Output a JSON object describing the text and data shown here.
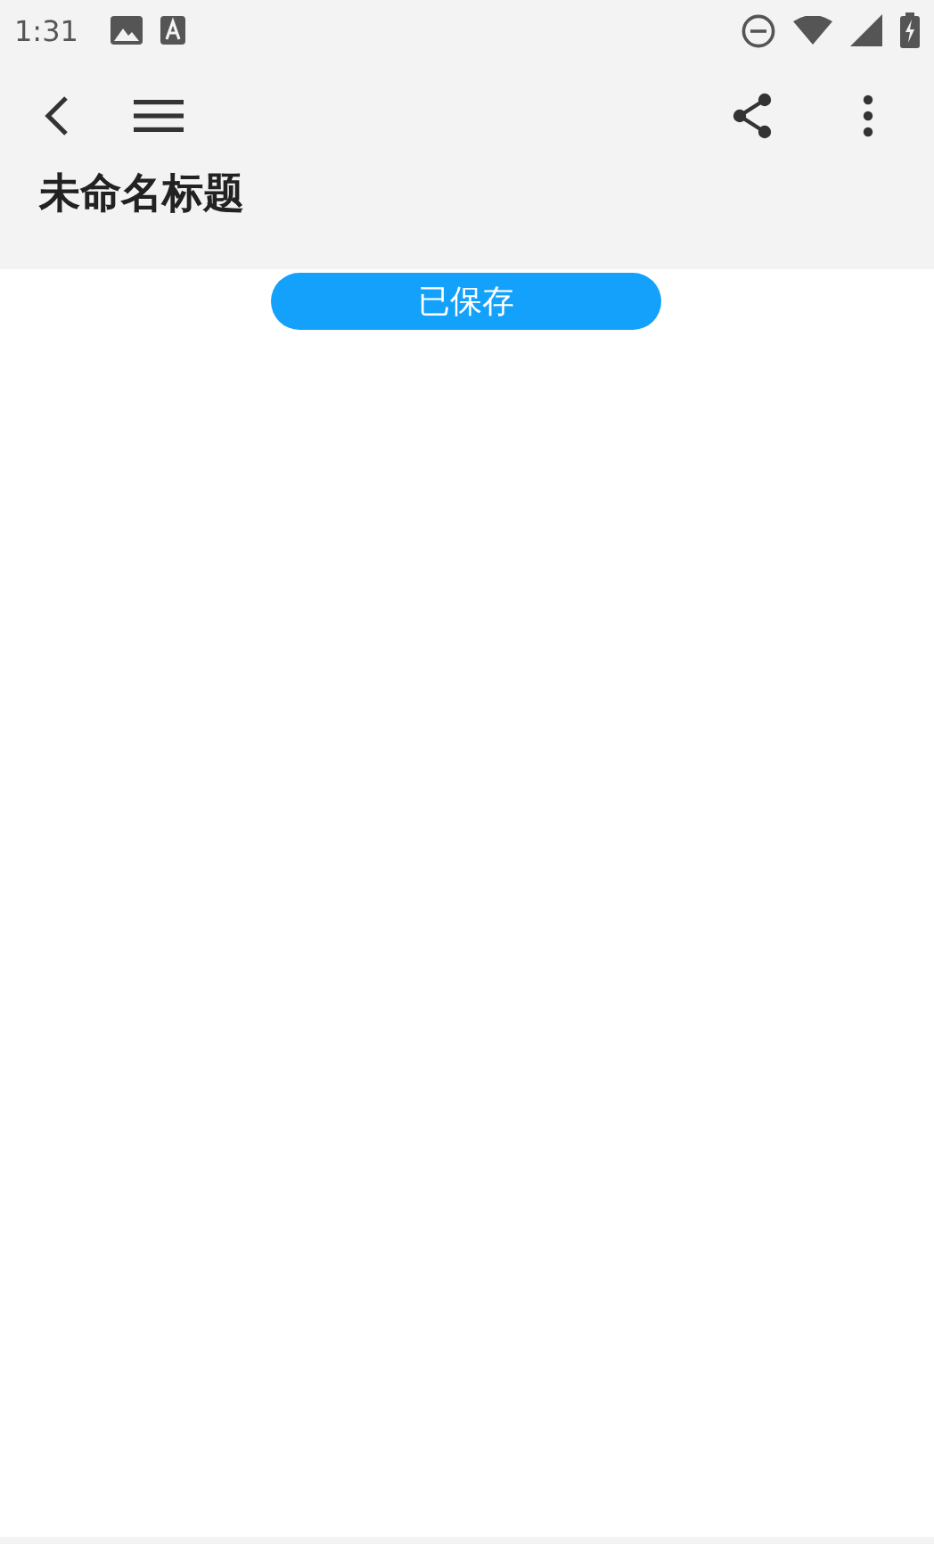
{
  "status_bar": {
    "time": "1:31"
  },
  "note": {
    "title": "未命名标题",
    "save_status": "已保存"
  }
}
